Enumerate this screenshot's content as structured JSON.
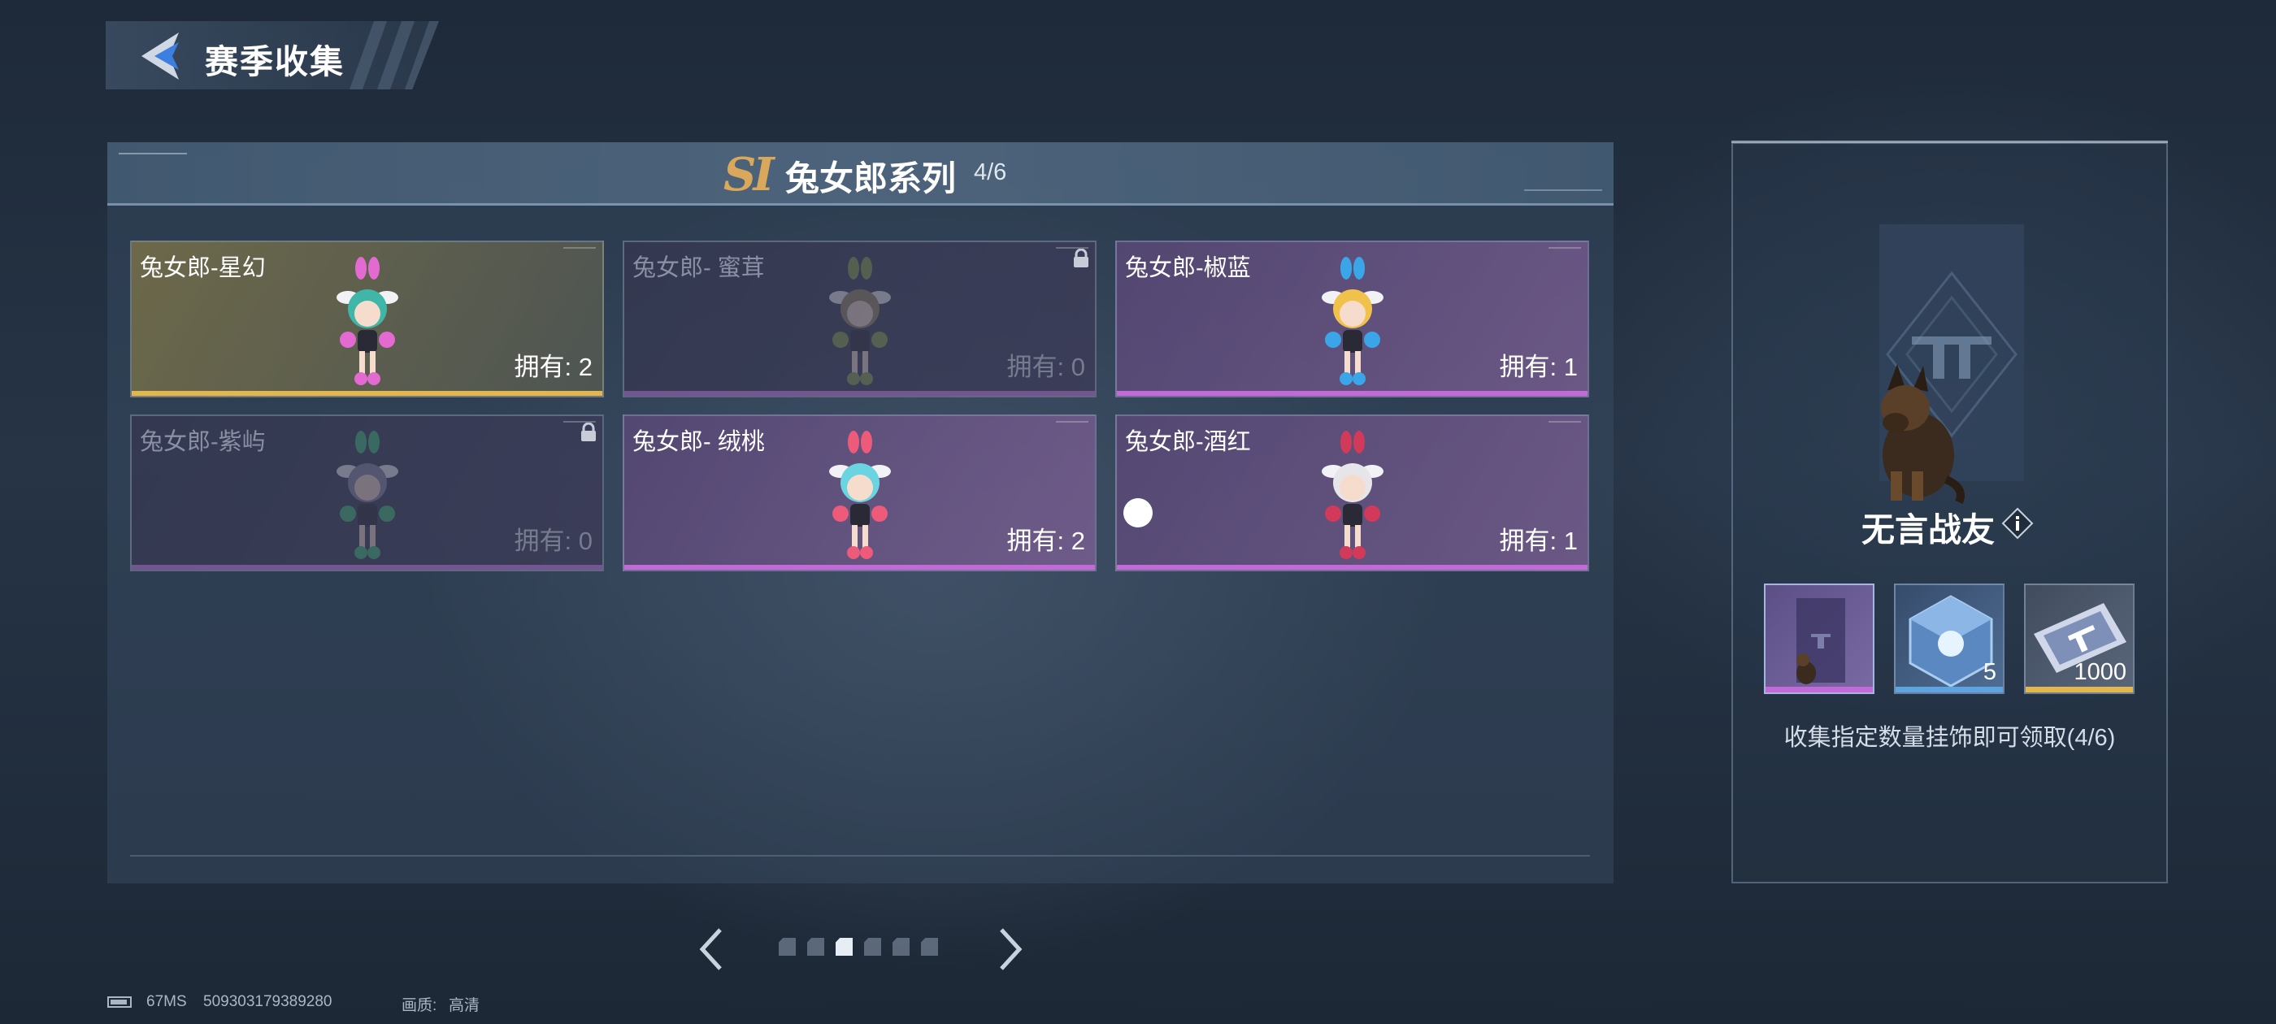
{
  "header": {
    "title": "赛季收集",
    "back_icon": "back-arrow-icon"
  },
  "series": {
    "badge": "SI",
    "title": "兔女郎系列",
    "progress": "4/6"
  },
  "cards": [
    {
      "name": "兔女郎-星幻",
      "owned": "拥有: 2",
      "rarity": "gold",
      "locked": false,
      "hair": "#3fb6a8",
      "accent": "#e26ad0"
    },
    {
      "name": "兔女郎- 蜜茸",
      "owned": "拥有: 0",
      "rarity": "gold",
      "locked": true,
      "hair": "#9a8a66",
      "accent": "#8fa34b"
    },
    {
      "name": "兔女郎-椒蓝",
      "owned": "拥有: 1",
      "rarity": "purple",
      "locked": false,
      "hair": "#f0c24c",
      "accent": "#3aa6e8"
    },
    {
      "name": "兔女郎-紫屿",
      "owned": "拥有: 0",
      "rarity": "purple",
      "locked": true,
      "hair": "#8a86a6",
      "accent": "#3fbf7a"
    },
    {
      "name": "兔女郎- 绒桃",
      "owned": "拥有: 2",
      "rarity": "purple",
      "locked": false,
      "hair": "#6ad4e0",
      "accent": "#ee5a7a"
    },
    {
      "name": "兔女郎-酒红",
      "owned": "拥有: 1",
      "rarity": "purple",
      "locked": false,
      "hair": "#e6e6ea",
      "accent": "#d23a5a"
    }
  ],
  "pagination": {
    "pages": 6,
    "active_index": 2,
    "prev_icon": "chevron-left-icon",
    "next_icon": "chevron-right-icon"
  },
  "reward": {
    "name": "无言战友",
    "info_icon": "info-icon",
    "items": [
      {
        "icon": "dog-card-icon",
        "quantity": ""
      },
      {
        "icon": "crystal-cube-icon",
        "quantity": "5"
      },
      {
        "icon": "ticket-icon",
        "quantity": "1000"
      }
    ],
    "description": "收集指定数量挂饰即可领取(4/6)"
  },
  "status_bar": {
    "ping": "67MS",
    "uid": "509303179389280",
    "quality_label": "画质:",
    "quality_value": "高清"
  },
  "colors": {
    "gold": "#e3b74e",
    "purple": "#c46ad8",
    "blue": "#5fa4e0",
    "badge": "#d9a85a"
  }
}
